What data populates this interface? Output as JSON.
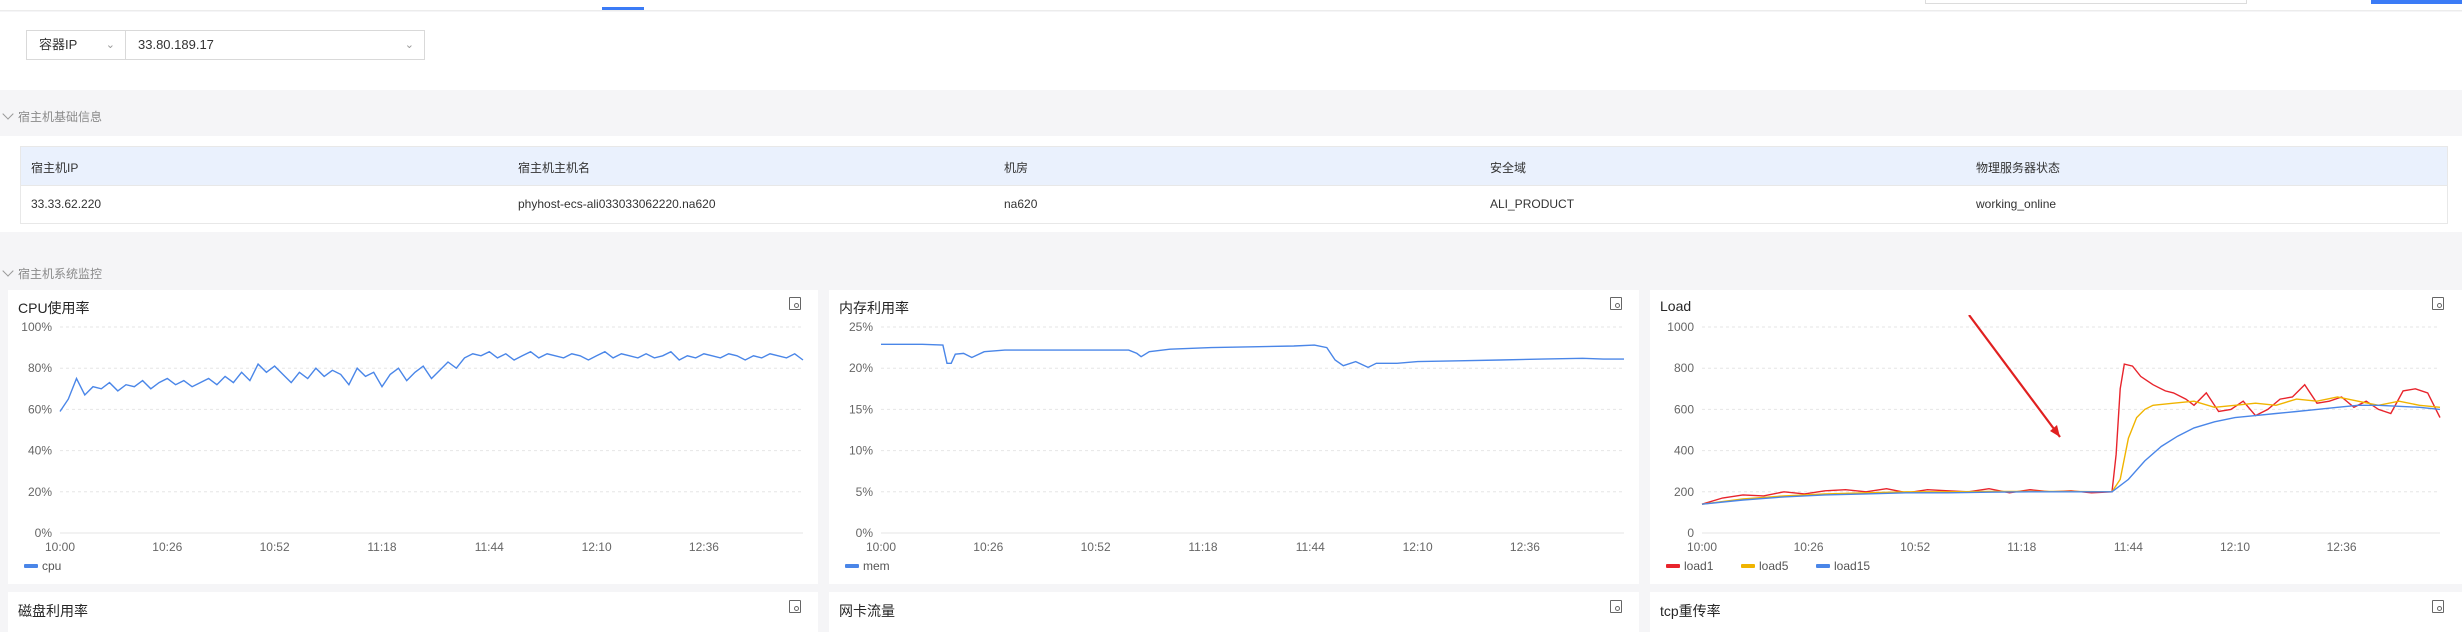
{
  "filter": {
    "type_select": "容器IP",
    "ip_select": "33.80.189.17"
  },
  "host_info": {
    "section_title": "宿主机基础信息",
    "columns": [
      "宿主机IP",
      "宿主机主机名",
      "机房",
      "安全域",
      "物理服务器状态"
    ],
    "row": [
      "33.33.62.220",
      "phyhost-ecs-ali033033062220.na620",
      "na620",
      "ALI_PRODUCT",
      "working_online"
    ]
  },
  "monitor": {
    "section_title": "宿主机系统监控"
  },
  "icons": {
    "card_action": "detail-search-icon"
  },
  "colors": {
    "accent": "#3b7bf6",
    "cpu": "#4a86e8",
    "mem": "#4a86e8",
    "load1": "#e8242c",
    "load5": "#f0b400",
    "load15": "#4a86e8",
    "annotation_arrow": "#e02020"
  },
  "charts_row2": {
    "disk": "磁盘利用率",
    "net": "网卡流量",
    "tcp": "tcp重传率"
  },
  "chart_data": [
    {
      "type": "line",
      "title": "CPU使用率",
      "x_ticks": [
        "10:00",
        "10:26",
        "10:52",
        "11:18",
        "11:44",
        "12:10",
        "12:36"
      ],
      "y_ticks": [
        "0%",
        "20%",
        "40%",
        "60%",
        "80%",
        "100%"
      ],
      "ylim": [
        0,
        100
      ],
      "x_range_minutes": [
        0,
        180
      ],
      "series": [
        {
          "name": "cpu",
          "x": [
            0,
            2,
            4,
            6,
            8,
            10,
            12,
            14,
            16,
            18,
            20,
            22,
            24,
            26,
            28,
            30,
            32,
            34,
            36,
            38,
            40,
            42,
            44,
            46,
            48,
            50,
            52,
            54,
            56,
            58,
            60,
            62,
            64,
            66,
            68,
            70,
            72,
            74,
            76,
            78,
            80,
            82,
            84,
            86,
            88,
            90,
            92,
            94,
            96,
            98,
            100,
            102,
            104,
            106,
            108,
            110,
            112,
            114,
            116,
            118,
            120,
            122,
            124,
            126,
            128,
            130,
            132,
            134,
            136,
            138,
            140,
            142,
            144,
            146,
            148,
            150,
            152,
            154,
            156,
            158,
            160,
            162,
            164,
            166,
            168,
            170,
            172,
            174,
            176,
            178,
            180
          ],
          "values": [
            59,
            65,
            75,
            67,
            71,
            70,
            73,
            69,
            72,
            71,
            74,
            70,
            73,
            75,
            72,
            74,
            71,
            73,
            75,
            72,
            76,
            73,
            78,
            74,
            82,
            78,
            81,
            77,
            73,
            78,
            75,
            80,
            76,
            79,
            77,
            72,
            80,
            76,
            78,
            71,
            77,
            80,
            74,
            78,
            81,
            75,
            79,
            83,
            80,
            85,
            87,
            86,
            88,
            85,
            87,
            84,
            86,
            88,
            85,
            87,
            86,
            85,
            87,
            86,
            84,
            86,
            88,
            85,
            87,
            86,
            85,
            87,
            85,
            86,
            88,
            84,
            86,
            85,
            87,
            86,
            85,
            87,
            86,
            84,
            86,
            85,
            87,
            86,
            85,
            87,
            84
          ]
        }
      ]
    },
    {
      "type": "line",
      "title": "内存利用率",
      "x_ticks": [
        "10:00",
        "10:26",
        "10:52",
        "11:18",
        "11:44",
        "12:10",
        "12:36"
      ],
      "y_ticks": [
        "0%",
        "5%",
        "10%",
        "15%",
        "20%",
        "25%"
      ],
      "ylim": [
        0,
        25
      ],
      "x_range_minutes": [
        0,
        180
      ],
      "series": [
        {
          "name": "mem",
          "x": [
            0,
            5,
            10,
            15,
            16,
            17,
            18,
            20,
            22,
            25,
            30,
            40,
            50,
            60,
            62,
            63,
            65,
            70,
            80,
            90,
            100,
            105,
            108,
            110,
            112,
            115,
            118,
            120,
            125,
            130,
            140,
            150,
            160,
            170,
            175,
            180
          ],
          "values": [
            22.9,
            22.9,
            22.9,
            22.8,
            20.6,
            20.6,
            21.7,
            21.8,
            21.3,
            22,
            22.2,
            22.2,
            22.2,
            22.2,
            21.8,
            21.4,
            22,
            22.3,
            22.5,
            22.6,
            22.7,
            22.8,
            22.5,
            21,
            20.3,
            20.8,
            20.1,
            20.6,
            20.6,
            20.8,
            20.9,
            21.0,
            21.1,
            21.2,
            21.1,
            21.1
          ]
        }
      ]
    },
    {
      "type": "line",
      "title": "Load",
      "x_ticks": [
        "10:00",
        "10:26",
        "10:52",
        "11:18",
        "11:44",
        "12:10",
        "12:36"
      ],
      "y_ticks": [
        "0",
        "200",
        "400",
        "600",
        "800",
        "1000"
      ],
      "ylim": [
        0,
        1000
      ],
      "x_range_minutes": [
        0,
        180
      ],
      "annotation": "arrow",
      "series": [
        {
          "name": "load1",
          "x": [
            0,
            5,
            10,
            15,
            20,
            25,
            30,
            35,
            40,
            45,
            50,
            55,
            60,
            65,
            70,
            75,
            80,
            85,
            90,
            95,
            100,
            101,
            102,
            103,
            105,
            107,
            110,
            113,
            115,
            118,
            120,
            123,
            126,
            129,
            132,
            135,
            138,
            141,
            144,
            147,
            150,
            153,
            156,
            159,
            162,
            165,
            168,
            171,
            174,
            177,
            180
          ],
          "values": [
            140,
            170,
            185,
            180,
            200,
            190,
            205,
            210,
            200,
            215,
            195,
            210,
            205,
            200,
            215,
            195,
            210,
            200,
            205,
            195,
            200,
            380,
            700,
            820,
            810,
            760,
            720,
            690,
            680,
            650,
            620,
            680,
            590,
            600,
            640,
            570,
            600,
            650,
            660,
            720,
            630,
            640,
            660,
            610,
            640,
            600,
            580,
            690,
            700,
            680,
            560
          ]
        },
        {
          "name": "load5",
          "x": [
            0,
            10,
            20,
            30,
            40,
            50,
            60,
            70,
            80,
            90,
            100,
            102,
            104,
            106,
            108,
            110,
            115,
            120,
            125,
            130,
            135,
            140,
            145,
            150,
            155,
            160,
            165,
            170,
            175,
            180
          ],
          "values": [
            140,
            165,
            180,
            190,
            195,
            200,
            200,
            202,
            202,
            202,
            200,
            260,
            460,
            560,
            600,
            620,
            630,
            640,
            610,
            620,
            630,
            620,
            650,
            640,
            660,
            640,
            620,
            640,
            620,
            610
          ]
        },
        {
          "name": "load15",
          "x": [
            0,
            10,
            20,
            30,
            40,
            50,
            60,
            70,
            80,
            90,
            100,
            104,
            108,
            112,
            116,
            120,
            125,
            130,
            135,
            140,
            145,
            150,
            155,
            160,
            165,
            170,
            175,
            180
          ],
          "values": [
            140,
            160,
            175,
            185,
            190,
            195,
            195,
            198,
            200,
            200,
            200,
            260,
            350,
            420,
            470,
            510,
            540,
            560,
            570,
            580,
            590,
            600,
            610,
            620,
            620,
            615,
            610,
            600
          ]
        }
      ]
    }
  ]
}
